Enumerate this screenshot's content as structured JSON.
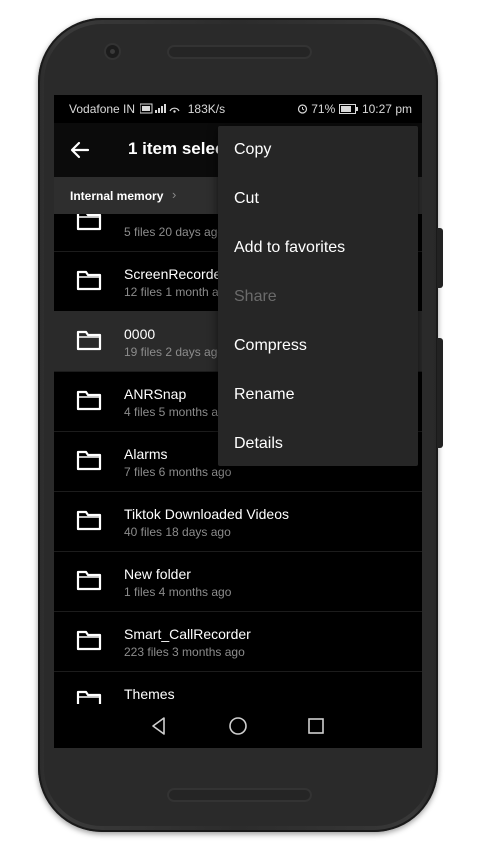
{
  "status_bar": {
    "carrier": "Vodafone IN",
    "speed": "183K/s",
    "battery": "71%",
    "time": "10:27 pm"
  },
  "app_bar": {
    "title": "1 item selected"
  },
  "breadcrumb": {
    "label": "Internal memory",
    "chevron": "›"
  },
  "folders": [
    {
      "name": "",
      "meta": "5 files   20 days ago",
      "selected": false
    },
    {
      "name": "ScreenRecorder",
      "meta": "12 files   1 month ago",
      "selected": false
    },
    {
      "name": "0000",
      "meta": "19 files   2 days ago",
      "selected": true
    },
    {
      "name": "ANRSnap",
      "meta": "4 files   5 months ago",
      "selected": false
    },
    {
      "name": "Alarms",
      "meta": "7 files   6 months ago",
      "selected": false
    },
    {
      "name": "Tiktok Downloaded Videos",
      "meta": "40 files   18 days ago",
      "selected": false
    },
    {
      "name": "New folder",
      "meta": "1 files   4 months ago",
      "selected": false
    },
    {
      "name": "Smart_CallRecorder",
      "meta": "223 files   3 months ago",
      "selected": false
    },
    {
      "name": "Themes",
      "meta": "",
      "selected": false
    }
  ],
  "context_menu": {
    "items": [
      {
        "label": "Copy",
        "enabled": true
      },
      {
        "label": "Cut",
        "enabled": true
      },
      {
        "label": "Add to favorites",
        "enabled": true
      },
      {
        "label": "Share",
        "enabled": false
      },
      {
        "label": "Compress",
        "enabled": true
      },
      {
        "label": "Rename",
        "enabled": true
      },
      {
        "label": "Details",
        "enabled": true
      }
    ]
  },
  "icons": {
    "back": "arrow-left-icon",
    "folder": "folder-icon",
    "nav_back": "triangle-back-icon",
    "nav_home": "circle-home-icon",
    "nav_recents": "square-recents-icon"
  },
  "colors": {
    "screen_bg": "#000000",
    "menu_bg": "#262626",
    "selected_row": "#2a2a2a",
    "breadcrumb_bg": "#2e2e2e",
    "disabled_text": "#6b6b6b"
  }
}
